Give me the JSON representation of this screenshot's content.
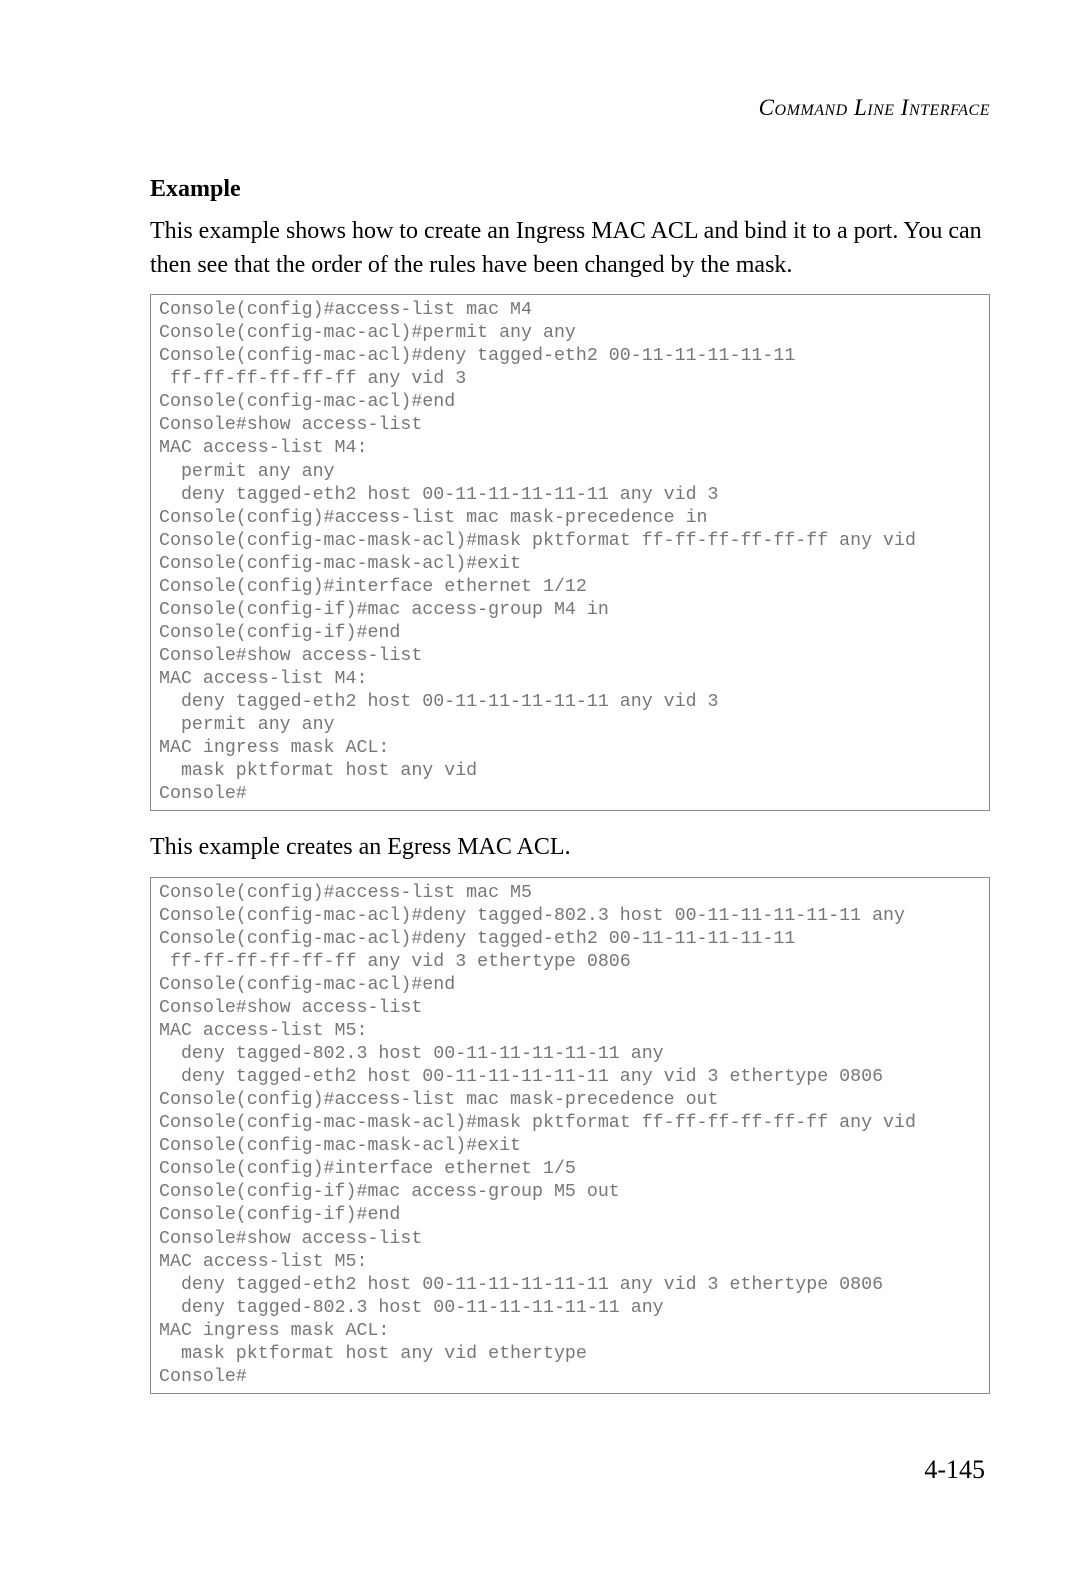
{
  "running_header": "Command Line Interface",
  "heading": "Example",
  "para1": "This example shows how to create an Ingress MAC ACL and bind it to a port. You can then see that the order of the rules have been changed by the mask.",
  "console1": "Console(config)#access-list mac M4\nConsole(config-mac-acl)#permit any any\nConsole(config-mac-acl)#deny tagged-eth2 00-11-11-11-11-11 \n ff-ff-ff-ff-ff-ff any vid 3\nConsole(config-mac-acl)#end\nConsole#show access-list\nMAC access-list M4:\n  permit any any\n  deny tagged-eth2 host 00-11-11-11-11-11 any vid 3\nConsole(config)#access-list mac mask-precedence in\nConsole(config-mac-mask-acl)#mask pktformat ff-ff-ff-ff-ff-ff any vid\nConsole(config-mac-mask-acl)#exit\nConsole(config)#interface ethernet 1/12\nConsole(config-if)#mac access-group M4 in\nConsole(config-if)#end\nConsole#show access-list\nMAC access-list M4:\n  deny tagged-eth2 host 00-11-11-11-11-11 any vid 3\n  permit any any\nMAC ingress mask ACL:\n  mask pktformat host any vid\nConsole#",
  "para2": "This example creates an Egress MAC ACL.",
  "console2": "Console(config)#access-list mac M5\nConsole(config-mac-acl)#deny tagged-802.3 host 00-11-11-11-11-11 any\nConsole(config-mac-acl)#deny tagged-eth2 00-11-11-11-11-11 \n ff-ff-ff-ff-ff-ff any vid 3 ethertype 0806\nConsole(config-mac-acl)#end\nConsole#show access-list\nMAC access-list M5:\n  deny tagged-802.3 host 00-11-11-11-11-11 any\n  deny tagged-eth2 host 00-11-11-11-11-11 any vid 3 ethertype 0806\nConsole(config)#access-list mac mask-precedence out\nConsole(config-mac-mask-acl)#mask pktformat ff-ff-ff-ff-ff-ff any vid \nConsole(config-mac-mask-acl)#exit\nConsole(config)#interface ethernet 1/5\nConsole(config-if)#mac access-group M5 out\nConsole(config-if)#end\nConsole#show access-list\nMAC access-list M5:\n  deny tagged-eth2 host 00-11-11-11-11-11 any vid 3 ethertype 0806\n  deny tagged-802.3 host 00-11-11-11-11-11 any\nMAC ingress mask ACL:\n  mask pktformat host any vid ethertype\nConsole#",
  "page_number": "4-145"
}
